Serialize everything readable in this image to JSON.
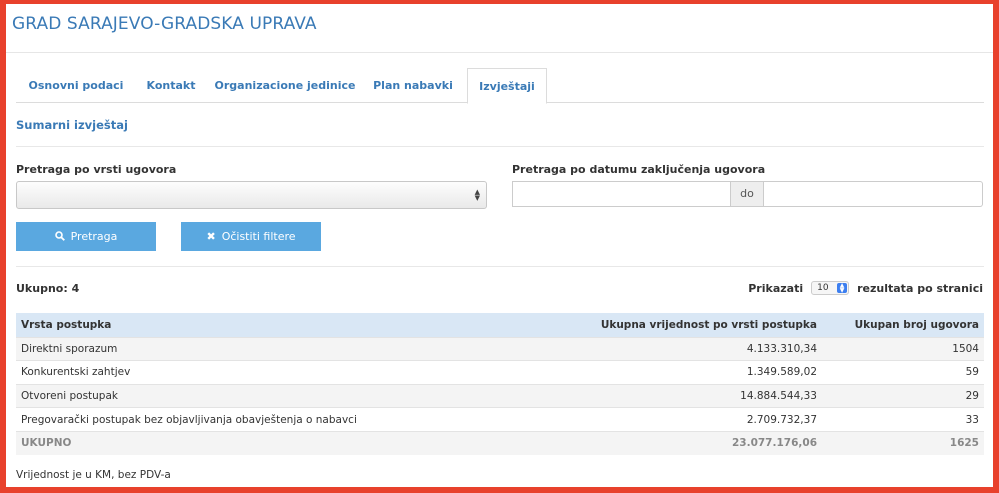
{
  "header": {
    "title": "GRAD SARAJEVO-GRADSKA UPRAVA"
  },
  "tabs": [
    {
      "label": "Osnovni podaci",
      "active": false
    },
    {
      "label": "Kontakt",
      "active": false
    },
    {
      "label": "Organizacione jedinice",
      "active": false
    },
    {
      "label": "Plan nabavki",
      "active": false
    },
    {
      "label": "Izvještaji",
      "active": true
    }
  ],
  "section": {
    "title": "Sumarni izvještaj"
  },
  "filters": {
    "contract_type_label": "Pretraga po vrsti ugovora",
    "contract_type_value": "",
    "date_label": "Pretraga po datumu zaključenja ugovora",
    "date_from_value": "",
    "date_separator": "do",
    "date_to_value": "",
    "search_button": "Pretraga",
    "clear_button": "Očistiti filtere"
  },
  "summary": {
    "total_label": "Ukupno: 4",
    "show_label": "Prikazati",
    "per_page": "10",
    "per_page_suffix": "rezultata po stranici"
  },
  "table": {
    "columns": [
      "Vrsta postupka",
      "Ukupna vrijednost po vrsti postupka",
      "Ukupan broj ugovora"
    ],
    "rows": [
      {
        "type": "Direktni sporazum",
        "value": "4.133.310,34",
        "count": "1504"
      },
      {
        "type": "Konkurentski zahtjev",
        "value": "1.349.589,02",
        "count": "59"
      },
      {
        "type": "Otvoreni postupak",
        "value": "14.884.544,33",
        "count": "29"
      },
      {
        "type": "Pregovarački postupak bez objavljivanja obavještenja o nabavci",
        "value": "2.709.732,37",
        "count": "33"
      }
    ],
    "total": {
      "label": "UKUPNO",
      "value": "23.077.176,06",
      "count": "1625"
    }
  },
  "footer": {
    "note": "Vrijednost je u KM, bez PDV-a"
  },
  "icons": {
    "search": "search-icon",
    "clear": "close-icon",
    "select_arrows": "updown-arrows-icon"
  },
  "colors": {
    "frame": "#e8412c",
    "accent": "#3a7ab6",
    "button": "#5aa8e0",
    "table_header": "#d9e7f5"
  }
}
